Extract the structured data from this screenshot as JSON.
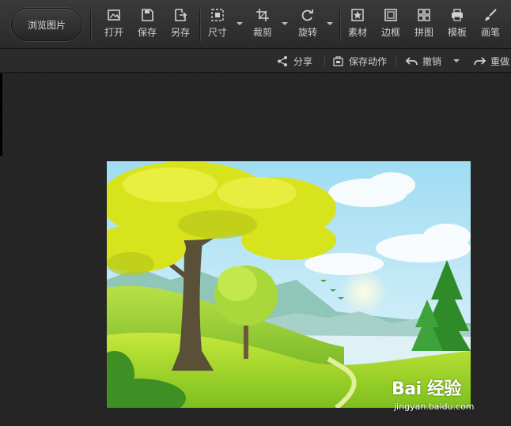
{
  "toolbar": {
    "browse": "浏览图片",
    "tools": [
      {
        "label": "打开",
        "icon": "open-icon"
      },
      {
        "label": "保存",
        "icon": "save-icon"
      },
      {
        "label": "另存",
        "icon": "save-as-icon"
      },
      {
        "label": "尺寸",
        "icon": "resize-icon"
      },
      {
        "label": "裁剪",
        "icon": "crop-icon"
      },
      {
        "label": "旋转",
        "icon": "rotate-icon"
      },
      {
        "label": "素材",
        "icon": "star-icon"
      },
      {
        "label": "边框",
        "icon": "frame-icon"
      },
      {
        "label": "拼图",
        "icon": "grid-icon"
      },
      {
        "label": "模板",
        "icon": "printer-icon"
      },
      {
        "label": "画笔",
        "icon": "brush-icon"
      }
    ]
  },
  "subbar": {
    "share": "分享",
    "save_action": "保存动作",
    "undo": "撤销",
    "redo": "重做"
  },
  "watermark": {
    "main": "Bai 经验",
    "sub": "jingyan.baidu.com"
  }
}
